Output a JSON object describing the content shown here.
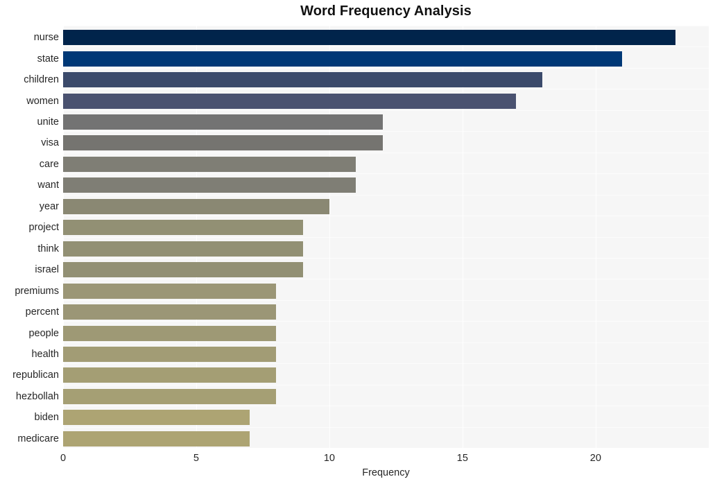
{
  "chart_data": {
    "type": "bar",
    "orientation": "horizontal",
    "title": "Word Frequency Analysis",
    "xlabel": "Frequency",
    "ylabel": "",
    "categories": [
      "nurse",
      "state",
      "children",
      "women",
      "unite",
      "visa",
      "care",
      "want",
      "year",
      "project",
      "think",
      "israel",
      "premiums",
      "percent",
      "people",
      "health",
      "republican",
      "hezbollah",
      "biden",
      "medicare"
    ],
    "values": [
      23,
      21,
      18,
      17,
      12,
      12,
      11,
      11,
      10,
      9,
      9,
      9,
      8,
      8,
      8,
      8,
      8,
      8,
      7,
      7
    ],
    "bar_colors": [
      "#01244b",
      "#003876",
      "#3b4a6b",
      "#4a5270",
      "#737373",
      "#757470",
      "#7f7e75",
      "#7f7e75",
      "#8a8873",
      "#929074",
      "#929074",
      "#929074",
      "#9b9676",
      "#9b9676",
      "#9e9975",
      "#a29c75",
      "#a49e74",
      "#a59f74",
      "#ada473",
      "#ada473"
    ],
    "xlim": [
      0,
      24.25
    ],
    "xticks": [
      0,
      5,
      10,
      15,
      20
    ],
    "xtick_labels": [
      "0",
      "5",
      "10",
      "15",
      "20"
    ],
    "grid": "vertical-and-horizontal",
    "plot_background": "#f6f6f6",
    "gridline_color": "#ffffff",
    "legend": "none"
  },
  "figure": {
    "title": "Word Frequency Analysis",
    "axis_title_x": "Frequency"
  }
}
